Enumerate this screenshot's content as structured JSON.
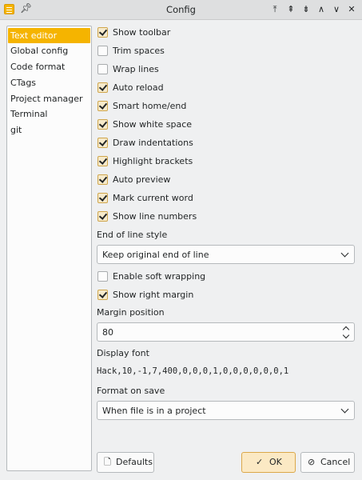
{
  "window": {
    "title": "Config",
    "controls": [
      "⤒",
      "⇞",
      "⇟",
      "∧",
      "∨",
      "✕"
    ]
  },
  "sidebar": {
    "items": [
      {
        "label": "Text editor",
        "selected": true
      },
      {
        "label": "Global config"
      },
      {
        "label": "Code format"
      },
      {
        "label": "CTags"
      },
      {
        "label": "Project manager"
      },
      {
        "label": "Terminal"
      },
      {
        "label": "git"
      }
    ]
  },
  "options": [
    {
      "label": "Show toolbar",
      "checked": true
    },
    {
      "label": "Trim spaces",
      "checked": false
    },
    {
      "label": "Wrap lines",
      "checked": false
    },
    {
      "label": "Auto reload",
      "checked": true
    },
    {
      "label": "Smart home/end",
      "checked": true
    },
    {
      "label": "Show white space",
      "checked": true
    },
    {
      "label": "Draw indentations",
      "checked": true
    },
    {
      "label": "Highlight brackets",
      "checked": true
    },
    {
      "label": "Auto preview",
      "checked": true
    },
    {
      "label": "Mark current word",
      "checked": true
    },
    {
      "label": "Show line numbers",
      "checked": true
    }
  ],
  "eol": {
    "label": "End of line style",
    "value": "Keep original end of line"
  },
  "soft_wrap": {
    "label": "Enable soft wrapping",
    "checked": false
  },
  "right_margin": {
    "label": "Show right margin",
    "checked": true
  },
  "margin_position": {
    "label": "Margin position",
    "value": "80"
  },
  "display_font": {
    "label": "Display font",
    "value": "Hack,10,-1,7,400,0,0,0,1,0,0,0,0,0,0,1"
  },
  "format_on_save": {
    "label": "Format on save",
    "value": "When file is in a project"
  },
  "buttons": {
    "defaults": "Defaults",
    "ok": "OK",
    "cancel": "Cancel"
  },
  "colors": {
    "accent": "#f5b400"
  }
}
